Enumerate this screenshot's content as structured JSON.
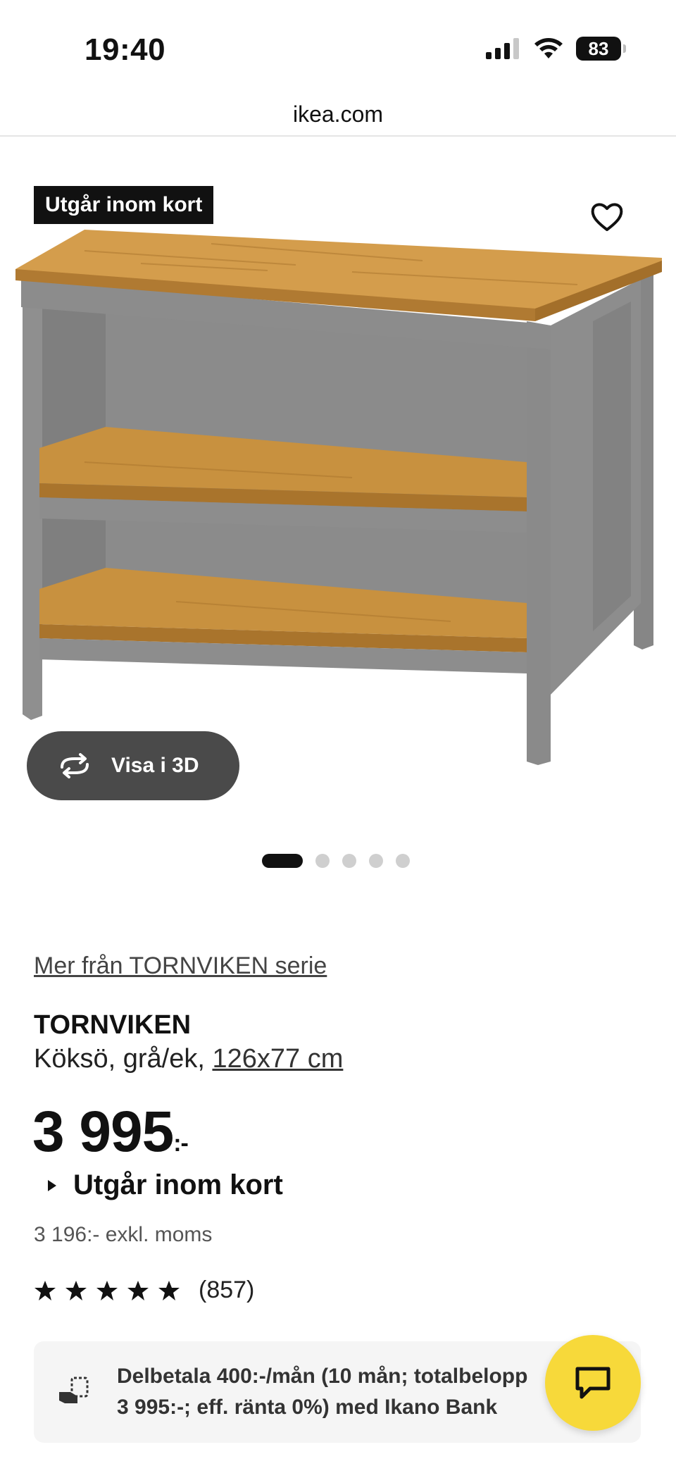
{
  "status_bar": {
    "time": "19:40",
    "battery": "83"
  },
  "browser": {
    "url": "ikea.com"
  },
  "gallery": {
    "badge": "Utgår inom kort",
    "view_3d_label": "Visa i 3D",
    "image_count": 5,
    "active_index": 0
  },
  "product": {
    "series_link": "Mer från TORNVIKEN serie",
    "name": "TORNVIKEN",
    "description": "Köksö, grå/ek,",
    "size": "126x77 cm",
    "price": "3 995",
    "price_suffix": ":-",
    "status": "Utgår inom kort",
    "excl_vat": "3 196:- exkl. moms",
    "rating_stars": 5,
    "rating_count": "(857)"
  },
  "finance": {
    "line1": "Delbetala 400:-/mån (10 mån; totalbelopp",
    "line2": "3 995:-; eff. ränta 0%) med Ikano Bank"
  },
  "colors": {
    "chat": "#f7d93a",
    "dark_button": "#4a4a4a",
    "wood": "#c8913f",
    "frame": "#8f8f8f"
  }
}
